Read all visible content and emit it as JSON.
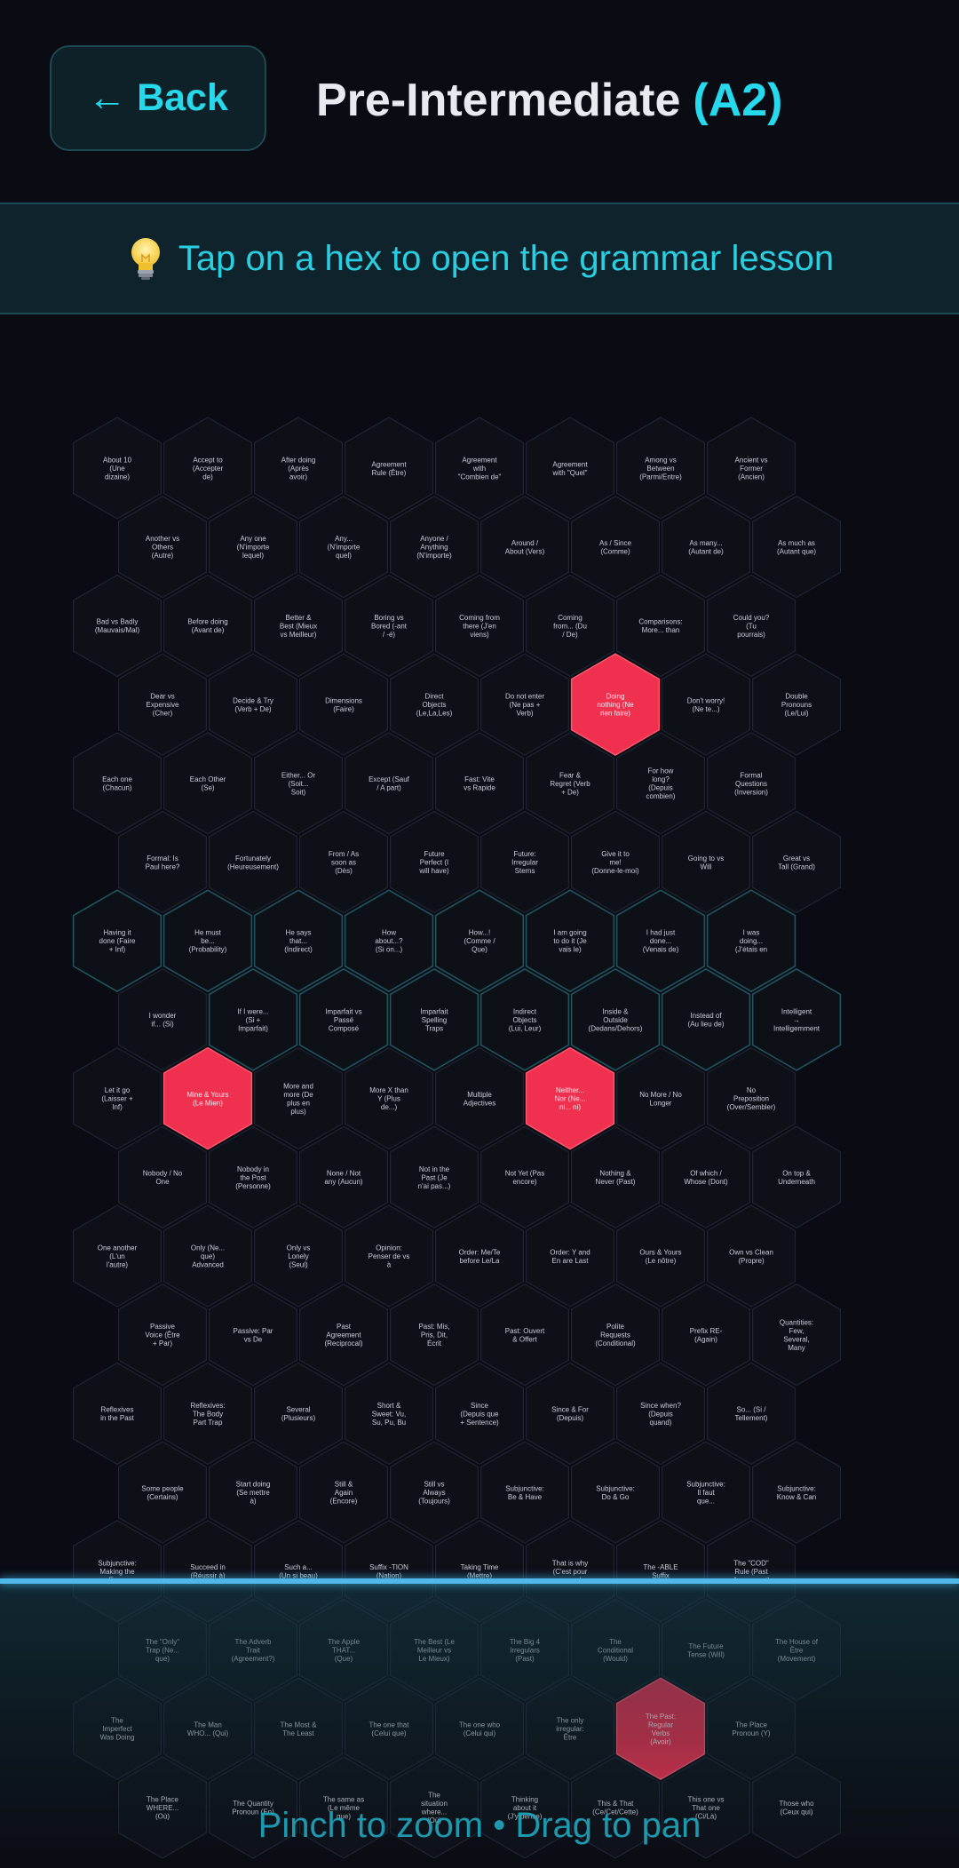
{
  "header": {
    "back_label": "← Back",
    "title": "Pre-Intermediate",
    "level": "(A2)"
  },
  "tip": {
    "icon": "lightbulb-icon",
    "text": "Tap on a hex to open the grammar lesson"
  },
  "hint": "Pinch to zoom • Drag to pan",
  "colors": {
    "background": "#0b0c13",
    "accent": "#26d9ec",
    "highlight_hex": "#f0304f",
    "hex_fill": "#0e1018",
    "hex_stroke": "#1f2432",
    "hex_stroke_teal": "#1e5560"
  },
  "hex_rows": [
    [
      "About 10 (Une dizaine)",
      "Accept to (Accepter de)",
      "After doing (Après avoir)",
      "Agreement Rule (Être)",
      "Agreement with \"Combien de\"",
      "Agreement with \"Quel\"",
      "Among vs Between (Parmi/Entre)",
      "Ancient vs Former (Ancien)"
    ],
    [
      "Another vs Others (Autre)",
      "Any one (N'importe lequel)",
      "Any... (N'importe quel)",
      "Anyone / Anything (N'importe)",
      "Around / About (Vers)",
      "As / Since (Comme)",
      "As many... (Autant de)",
      "As much as (Autant que)"
    ],
    [
      "Bad vs Badly (Mauvais/Mal)",
      "Before doing (Avant de)",
      "Better & Best (Mieux vs Meilleur)",
      "Boring vs Bored (-ant / -é)",
      "Coming from there (J'en viens)",
      "Coming from... (Du / De)",
      "Comparisons: More... than",
      "Could you? (Tu pourrais)"
    ],
    [
      "Dear vs Expensive (Cher)",
      "Decide & Try (Verb + De)",
      "Dimensions (Faire)",
      "Direct Objects (Le,La,Les)",
      "Do not enter (Ne pas + Verb)",
      "Doing nothing (Ne rien faire)",
      "Don't worry! (Ne te...)",
      "Double Pronouns (Le/Lui)"
    ],
    [
      "Each one (Chacun)",
      "Each Other (Se)",
      "Either... Or (Soit... Soit)",
      "Except (Sauf / A part)",
      "Fast: Vite vs Rapide",
      "Fear & Regret (Verb + De)",
      "For how long? (Depuis combien)",
      "Formal Questions (Inversion)"
    ],
    [
      "Formal: Is Paul here?",
      "Fortunately (Heureusement)",
      "From / As soon as (Dès)",
      "Future Perfect (I will have)",
      "Future: Irregular Stems",
      "Give it to me! (Donne-le-moi)",
      "Going to vs Will",
      "Great vs Tall (Grand)"
    ],
    [
      "Having it done (Faire + Inf)",
      "He must be... (Probability)",
      "He says that... (Indirect)",
      "How about...? (Si on...)",
      "How...! (Comme / Que)",
      "I am going to do it (Je vais le)",
      "I had just done... (Venais de)",
      "I was doing... (J'étais en"
    ],
    [
      "I wonder if... (Si)",
      "If I were... (Si + Imparfait)",
      "Imparfait vs Passé Composé",
      "Imparfait Spelling Traps",
      "Indirect Objects (Lui, Leur)",
      "Inside & Outside (Dedans/Dehors)",
      "Instead of (Au lieu de)",
      "Intelligent → Intelligemment"
    ],
    [
      "Let it go (Laisser + Inf)",
      "Mine & Yours (Le Mien)",
      "More and more (De plus en plus)",
      "More X than Y (Plus de...)",
      "Multiple Adjectives",
      "Neither... Nor (Ne... ni... ni)",
      "No More / No Longer",
      "No Preposition (Over/Sembler)"
    ],
    [
      "Nobody / No One",
      "Nobody in the Post (Personne)",
      "None / Not any (Aucun)",
      "Not in the Past (Je n'ai pas...)",
      "Not Yet (Pas encore)",
      "Nothing & Never (Past)",
      "Of which / Whose (Dont)",
      "On top & Underneath"
    ],
    [
      "One another (L'un l'autre)",
      "Only (Ne... que) Advanced",
      "Only vs Lonely (Seul)",
      "Opinion: Penser de vs à",
      "Order: Me/Te before Le/La",
      "Order: Y and En are Last",
      "Ours & Yours (Le nôtre)",
      "Own vs Clean (Propre)"
    ],
    [
      "Passive Voice (Être + Par)",
      "Passive: Par vs De",
      "Past Agreement (Reciprocal)",
      "Past: Mis, Pris, Dit, Écrit",
      "Past: Ouvert & Offert",
      "Polite Requests (Conditional)",
      "Prefix RE- (Again)",
      "Quantities: Few, Several, Many"
    ],
    [
      "Reflexives in the Past",
      "Reflexives: The Body Part Trap",
      "Several (Plusieurs)",
      "Short & Sweet: Vu, Su, Pu, Bu",
      "Since (Depuis que + Sentence)",
      "Since & For (Depuis)",
      "Since when? (Depuis quand)",
      "So... (Si / Tellement)"
    ],
    [
      "Some people (Certains)",
      "Start doing (Se mettre à)",
      "Still & Again (Encore)",
      "Still vs Always (Toujours)",
      "Subjunctive: Be & Have",
      "Subjunctive: Do & Go",
      "Subjunctive: Il faut que...",
      "Subjunctive: Know & Can"
    ],
    [
      "Subjunctive: Making the Form",
      "Succeed in (Réussir à)",
      "Such a... (Un si beau)",
      "Suffix -TION (Nation)",
      "Taking Time (Mettre)",
      "That is why (C'est pour ça que)",
      "The -ABLE Suffix",
      "The \"COD\" Rule (Past Agreement)"
    ],
    [
      "The \"Only\" Trap (Ne... que)",
      "The Adverb Trait (Agreement?)",
      "The Apple THAT... (Que)",
      "The Best (Le Meilleur vs Le Mieux)",
      "The Big 4 Irregulars (Past)",
      "The Conditional (Would)",
      "The Future Tense (Will)",
      "The House of Être (Movement)"
    ],
    [
      "The Imperfect Was Doing",
      "The Man WHO... (Qui)",
      "The Most & The Least",
      "The one that (Celui que)",
      "The one who (Celui qui)",
      "The only irregular: Être",
      "The Past: Regular Verbs (Avoir)",
      "The Place Pronoun (Y)"
    ],
    [
      "The Place WHERE... (Où)",
      "The Quantity Pronoun (En)",
      "The same as (Le même que)",
      "The situation where... (Où)",
      "Thinking about it (J'y pense)",
      "This & That (Ce/Cet/Cette)",
      "This one vs That one (Ci/Là)",
      "Those who (Ceux qui)"
    ]
  ],
  "highlighted": [
    [
      3,
      5
    ],
    [
      8,
      1
    ],
    [
      8,
      5
    ],
    [
      16,
      6
    ]
  ],
  "teal_outlined": [
    [
      6,
      0
    ],
    [
      6,
      1
    ],
    [
      6,
      2
    ],
    [
      6,
      3
    ],
    [
      6,
      4
    ],
    [
      6,
      5
    ],
    [
      6,
      6
    ],
    [
      6,
      7
    ],
    [
      7,
      1
    ],
    [
      7,
      2
    ],
    [
      7,
      3
    ],
    [
      7,
      4
    ],
    [
      7,
      5
    ],
    [
      7,
      6
    ],
    [
      7,
      7
    ]
  ]
}
